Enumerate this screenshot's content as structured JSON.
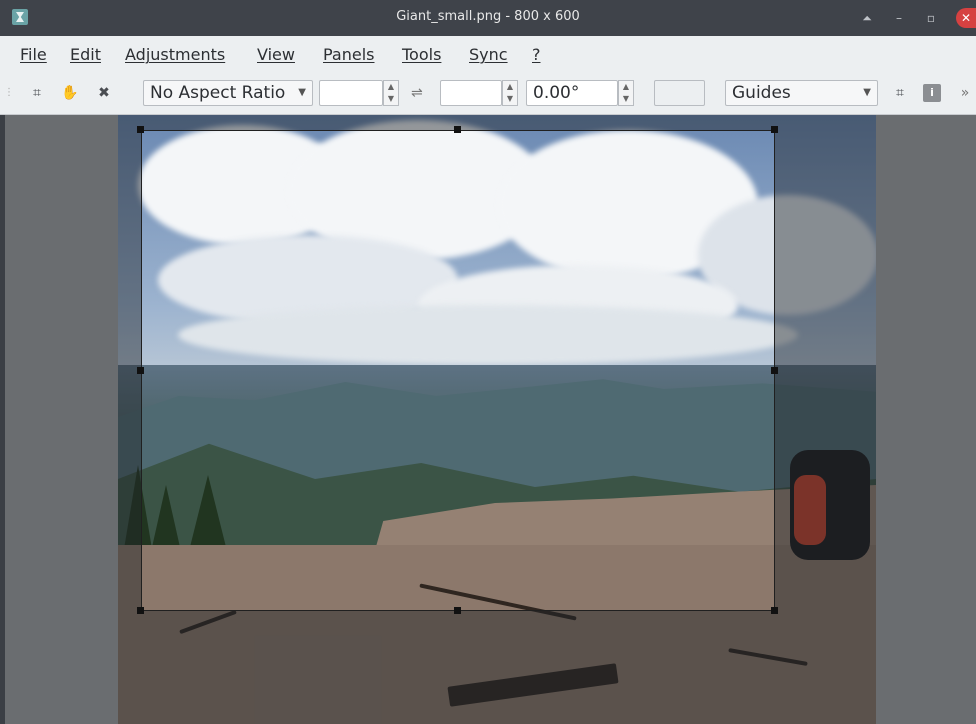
{
  "window": {
    "title": "Giant_small.png  - 800 x 600",
    "controls": {
      "up": "⏶",
      "minimize": "–",
      "restore": "▫",
      "close": "✕"
    }
  },
  "menu": [
    "File",
    "Edit",
    "Adjustments",
    "View",
    "Panels",
    "Tools",
    "Sync",
    "?"
  ],
  "toolbar": {
    "icons": [
      "crop-icon",
      "hand-icon",
      "cancel-icon",
      "crop-apply-icon",
      "info-icon"
    ],
    "aspect_ratio": "No Aspect Ratio",
    "width_value": "",
    "height_value": "",
    "swap_symbol": "⇌",
    "rotation_value": "0.00°",
    "guides": "Guides"
  },
  "colors": {
    "titlebar": "#3f434a",
    "menubar": "#eceff1",
    "close": "#d64141"
  }
}
